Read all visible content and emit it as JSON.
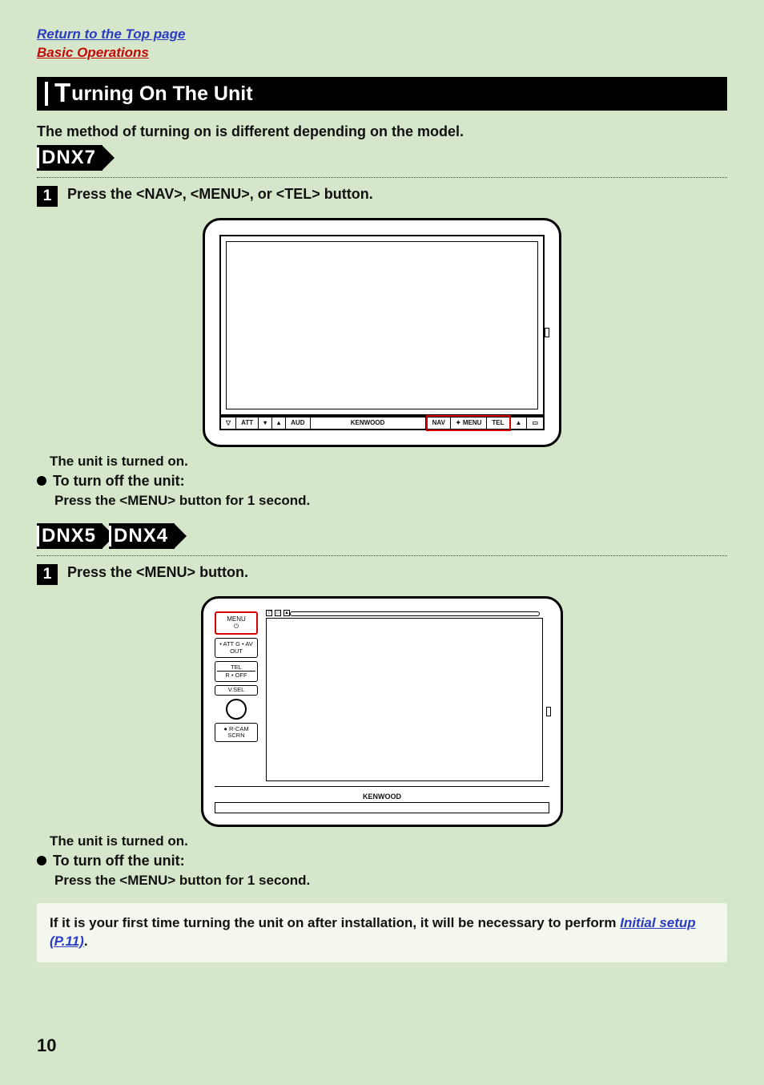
{
  "nav": {
    "top_link": "Return to the Top page",
    "section_link": "Basic Operations"
  },
  "heading": {
    "first_letter": "T",
    "rest": "urning On The Unit"
  },
  "intro": "The method of turning on is different depending on the model.",
  "dnx7": {
    "label": "DNX7",
    "step_num": "1",
    "step_text": "Press the <NAV>, <MENU>, or <TEL> button.",
    "panel": {
      "eject_icon": "▽",
      "att": "ATT",
      "down": "▾",
      "up": "▴",
      "aud": "AUD",
      "brand": "KENWOOD",
      "nav": "NAV",
      "menu": "✦ MENU",
      "tel": "TEL",
      "eject2": "▲",
      "screen": "▭"
    },
    "result": "The unit is turned on.",
    "sub_heading": "To turn off the unit:",
    "sub_body": "Press the <MENU> button for 1 second."
  },
  "dnx54": {
    "labels": [
      "DNX5",
      "DNX4"
    ],
    "step_num": "1",
    "step_text": "Press the <MENU> button.",
    "sidebar": {
      "menu": "MENU",
      "menu_icon": "⏻",
      "avout": "• ATT G\n• AV OUT",
      "tel": "TEL",
      "tel_sub": "R • OFF",
      "vol": "V.SEL",
      "rcam": "● R-CAM\nSCRN"
    },
    "brand": "KENWOOD",
    "result": "The unit is turned on.",
    "sub_heading": "To turn off the unit:",
    "sub_body": "Press the <MENU> button for 1 second."
  },
  "note": {
    "lead": "If it is your first time turning the unit on after installation, it will be necessary to perform ",
    "link": "Initial setup (P.11)",
    "tail": "."
  },
  "page_number": "10"
}
